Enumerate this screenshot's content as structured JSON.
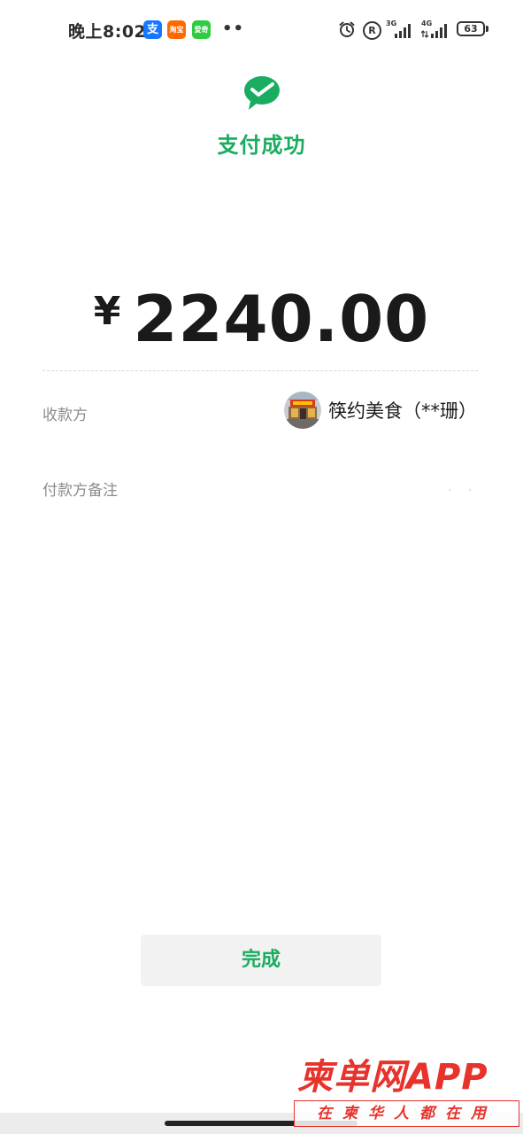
{
  "status_bar": {
    "time": "晚上8:02",
    "app_icons": [
      {
        "name": "alipay-icon",
        "glyph": "支",
        "color": "#1677ff"
      },
      {
        "name": "taobao-icon",
        "glyph": "淘宝",
        "color": "#ff6a00"
      },
      {
        "name": "iqiyi-icon",
        "glyph": "爱奇艺",
        "color": "#2ecc40"
      }
    ],
    "dots": "••",
    "r_badge": "R",
    "network_1": "3G",
    "network_2": "4G",
    "battery": "63"
  },
  "header": {
    "logo_icon": "wechat-pay-check-icon",
    "title": "支付成功",
    "accent_color": "#1aad5f"
  },
  "payment": {
    "currency_symbol": "¥",
    "amount": "2240.00"
  },
  "details": {
    "payee_label": "收款方",
    "payee_name": "筷约美食（**珊）",
    "remark_label": "付款方备注",
    "remark_value": "· ·"
  },
  "actions": {
    "done_label": "完成"
  },
  "watermark": {
    "title": "柬单网APP",
    "subtitle": "在柬华人都在用",
    "color": "#e8322c"
  }
}
